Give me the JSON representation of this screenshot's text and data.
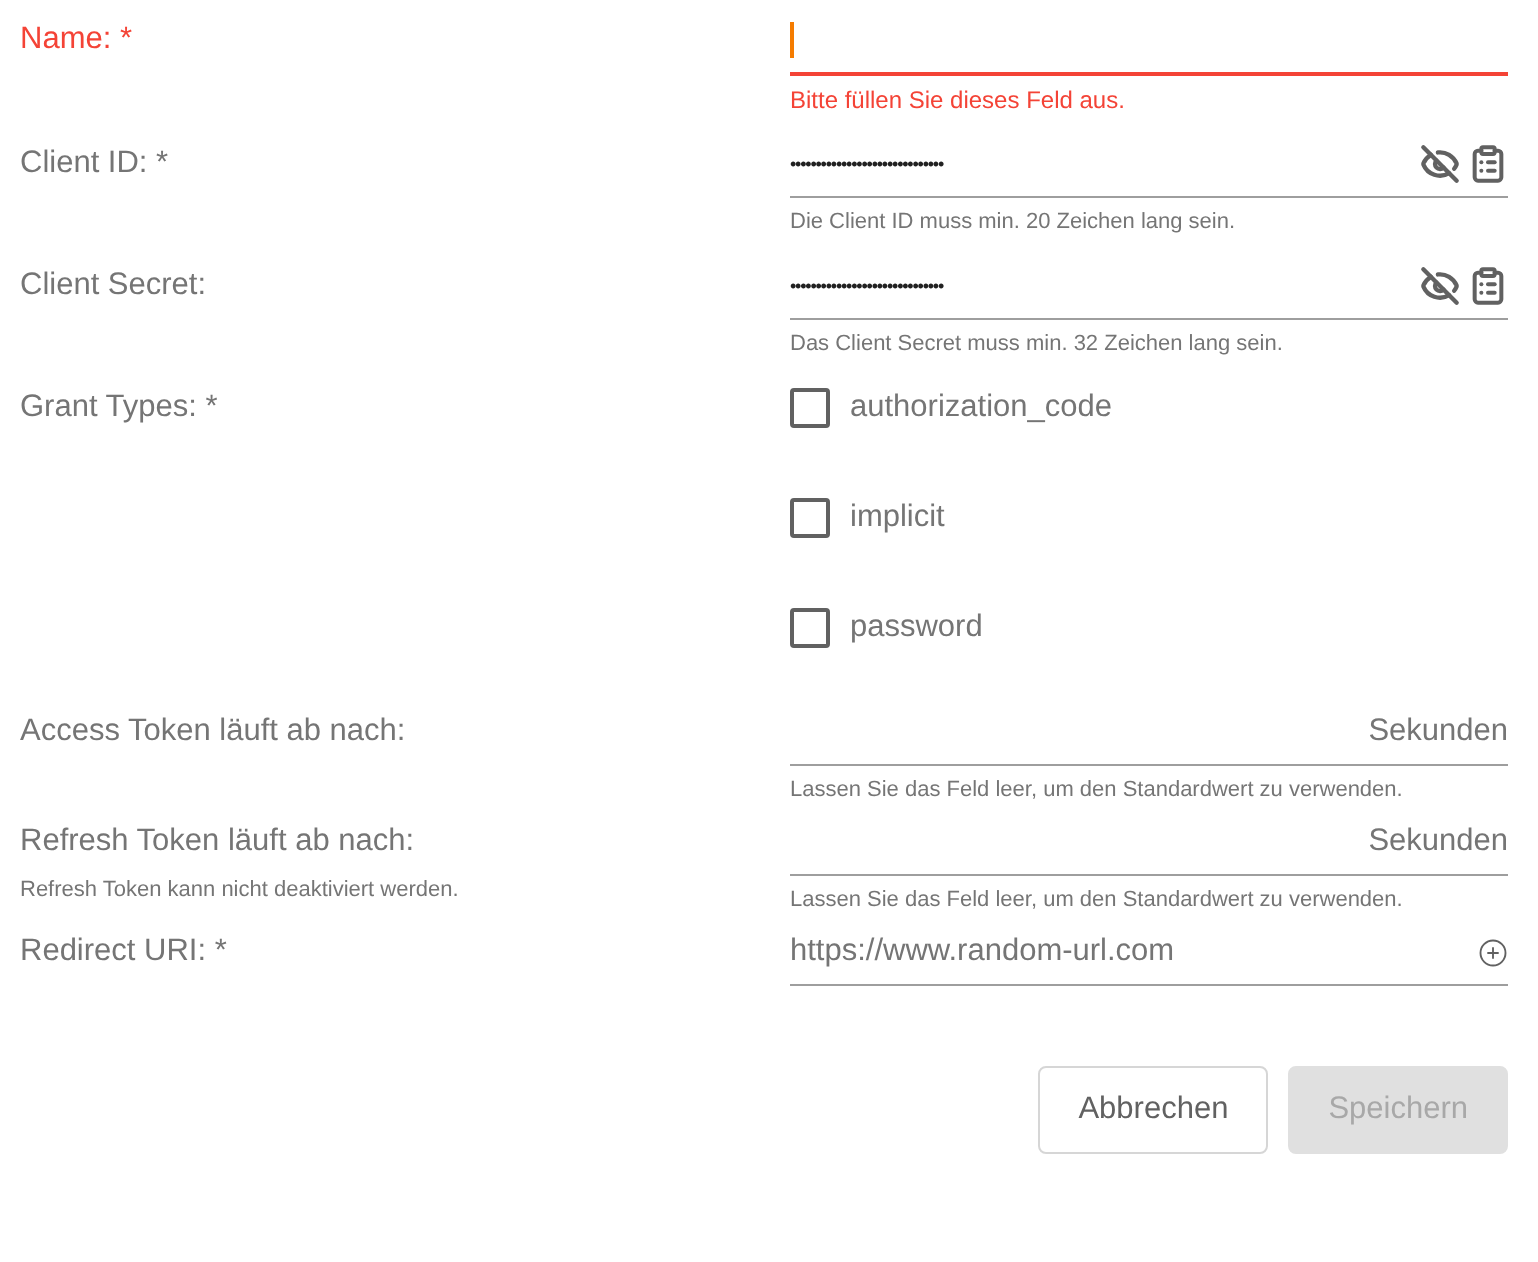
{
  "fields": [
    {
      "kind": "text",
      "label": "Name: *",
      "focused": true,
      "error": "Bitte füllen Sie dieses Feld aus."
    },
    {
      "kind": "secret",
      "label": "Client ID: *",
      "value": "••••••••••••••••••••••••••••••",
      "hint": "Die Client ID muss min. 20 Zeichen lang sein."
    },
    {
      "kind": "secret",
      "label": "Client Secret:",
      "value": "••••••••••••••••••••••••••••••",
      "hint": "Das Client Secret muss min. 32 Zeichen lang sein."
    },
    {
      "kind": "checkboxes",
      "label": "Grant Types: *",
      "options": [
        {
          "label": "authorization_code",
          "checked": false
        },
        {
          "label": "implicit",
          "checked": false
        },
        {
          "label": "password",
          "checked": false
        }
      ]
    },
    {
      "kind": "number",
      "label": "Access Token läuft ab nach:",
      "suffix": "Sekunden",
      "hint": "Lassen Sie das Feld leer, um den Standardwert zu verwenden."
    },
    {
      "kind": "number",
      "label": "Refresh Token läuft ab nach:",
      "note": "Refresh Token kann nicht deaktiviert werden.",
      "suffix": "Sekunden",
      "hint": "Lassen Sie das Feld leer, um den Standardwert zu verwenden."
    },
    {
      "kind": "url",
      "label": "Redirect URI: *",
      "placeholder": "https://www.random-url.com"
    }
  ],
  "buttons": [
    {
      "label": "Abbrechen",
      "disabled": false
    },
    {
      "label": "Speichern",
      "disabled": true
    }
  ]
}
